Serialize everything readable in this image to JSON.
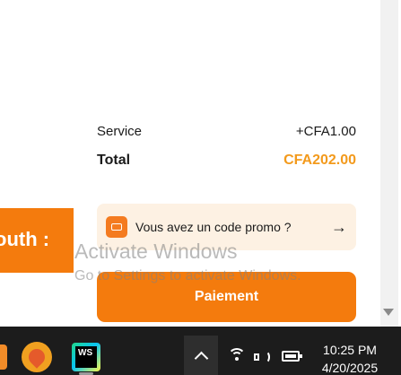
{
  "summary": {
    "service_label": "Service",
    "service_amount": "+CFA1.00",
    "total_label": "Total",
    "total_amount": "CFA202.00"
  },
  "promo": {
    "text": "Vous avez un code promo ?",
    "arrow": "→"
  },
  "banner": {
    "text": "outh :"
  },
  "payment": {
    "button_label": "Paiement"
  },
  "watermark": {
    "title": "Activate Windows",
    "subtitle": "Go to Settings to activate Windows."
  },
  "taskbar": {
    "time": "10:25 PM",
    "date": "4/20/2025",
    "ws_label": "WS"
  },
  "colors": {
    "accent": "#f47b0d",
    "total": "#f39a1c",
    "promo_bg": "#fdf1e3"
  }
}
